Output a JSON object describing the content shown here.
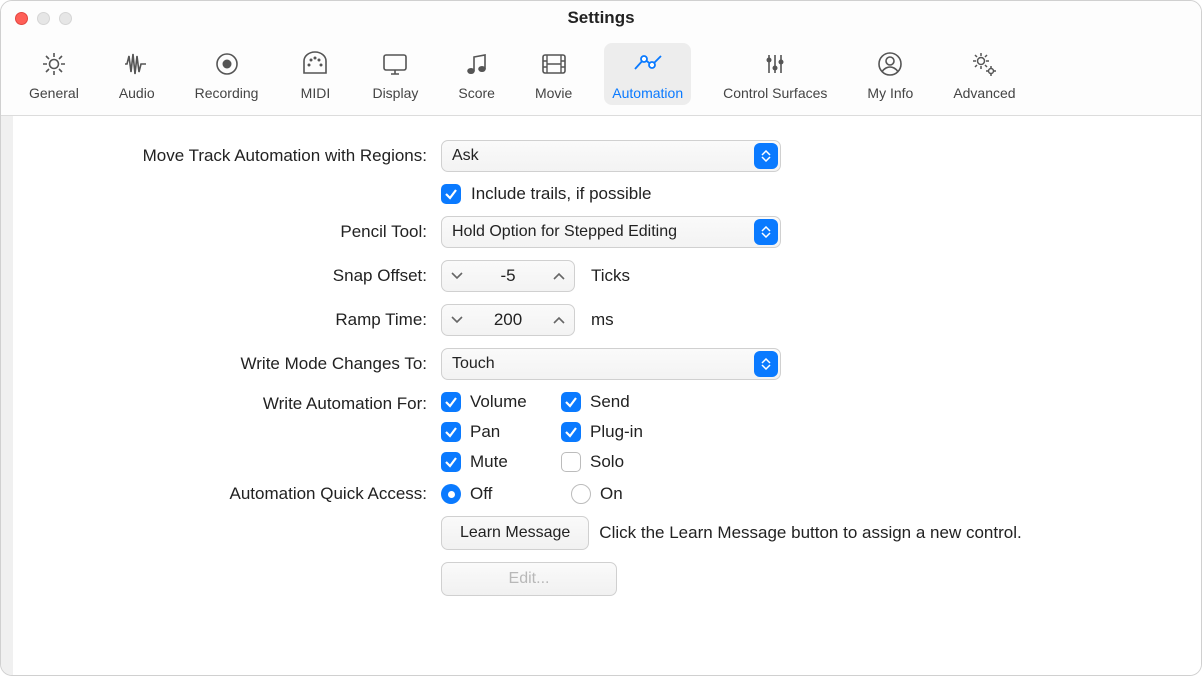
{
  "window": {
    "title": "Settings"
  },
  "toolbar": {
    "tabs": [
      {
        "label": "General"
      },
      {
        "label": "Audio"
      },
      {
        "label": "Recording"
      },
      {
        "label": "MIDI"
      },
      {
        "label": "Display"
      },
      {
        "label": "Score"
      },
      {
        "label": "Movie"
      },
      {
        "label": "Automation"
      },
      {
        "label": "Control Surfaces"
      },
      {
        "label": "My Info"
      },
      {
        "label": "Advanced"
      }
    ],
    "selected": "Automation"
  },
  "labels": {
    "moveTrack": "Move Track Automation with Regions:",
    "includeTrails": "Include trails, if possible",
    "pencilTool": "Pencil Tool:",
    "snapOffset": "Snap Offset:",
    "rampTime": "Ramp Time:",
    "writeMode": "Write Mode Changes To:",
    "writeAutoFor": "Write Automation For:",
    "quickAccess": "Automation Quick Access:",
    "learnHint": "Click the Learn Message button to assign a new control."
  },
  "values": {
    "moveTrack": "Ask",
    "includeTrailsChecked": true,
    "pencilTool": "Hold Option for Stepped Editing",
    "snapOffset": "-5",
    "snapOffsetUnit": "Ticks",
    "rampTime": "200",
    "rampTimeUnit": "ms",
    "writeMode": "Touch",
    "writeFor": {
      "volume": {
        "label": "Volume",
        "checked": true
      },
      "send": {
        "label": "Send",
        "checked": true
      },
      "pan": {
        "label": "Pan",
        "checked": true
      },
      "plugin": {
        "label": "Plug-in",
        "checked": true
      },
      "mute": {
        "label": "Mute",
        "checked": true
      },
      "solo": {
        "label": "Solo",
        "checked": false
      }
    },
    "quickAccess": {
      "off": "Off",
      "on": "On",
      "selected": "off"
    }
  },
  "buttons": {
    "learn": "Learn Message",
    "edit": "Edit..."
  }
}
